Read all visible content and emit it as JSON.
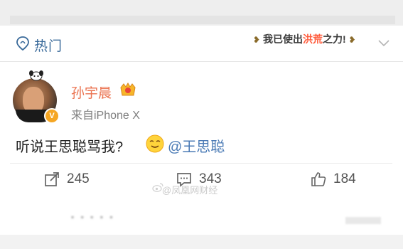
{
  "header": {
    "section_label": "热门",
    "slogan_prefix": "我已使出",
    "slogan_highlight": "洪荒",
    "slogan_suffix": "之力!"
  },
  "post": {
    "username": "孙宇晨",
    "source": "来自iPhone X",
    "text": "听说王思聪骂我?",
    "mention": "@王思聪",
    "name_color": "#eb7350",
    "mention_color": "#4a7ab5"
  },
  "actions": {
    "repost_count": "245",
    "comment_count": "343",
    "like_count": "184"
  },
  "watermark": "@凤凰网财经"
}
